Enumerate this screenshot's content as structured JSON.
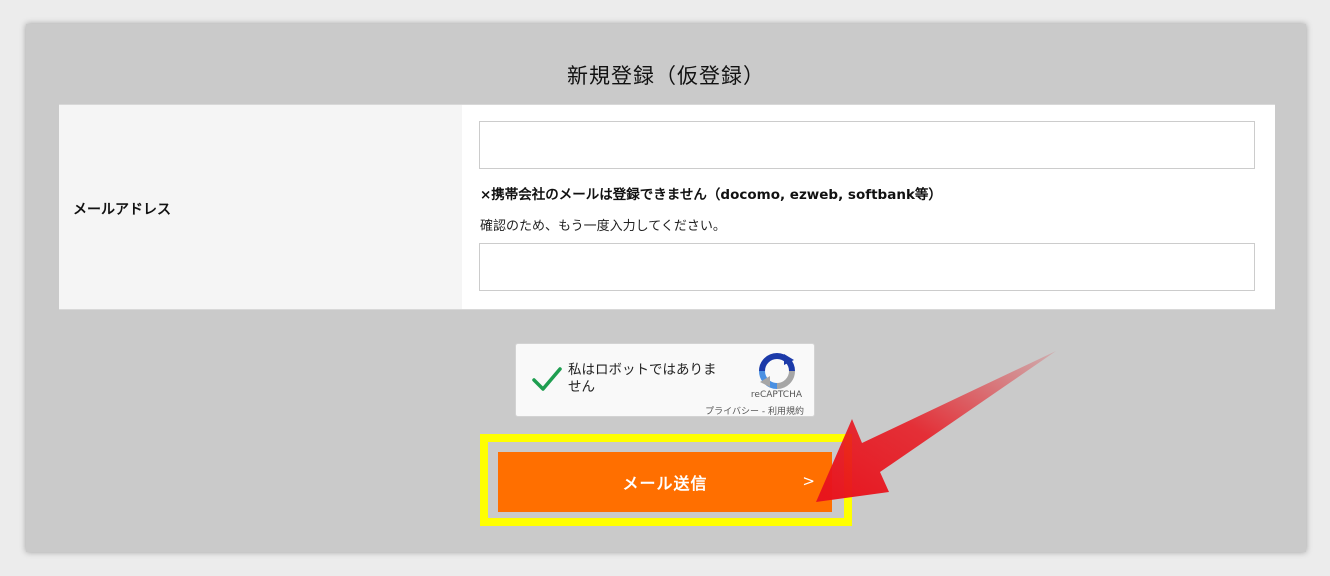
{
  "form": {
    "title": "新規登録（仮登録）",
    "email_label": "メールアドレス",
    "email_value": "",
    "email_confirm_value": "",
    "carrier_note": "×携帯会社のメールは登録できません（docomo, ezweb, softbank等）",
    "confirm_hint": "確認のため、もう一度入力してください。"
  },
  "captcha": {
    "label": "私はロボットではありません",
    "brand": "reCAPTCHA",
    "privacy": "プライバシー",
    "separator": " - ",
    "terms": "利用規約",
    "checked": true
  },
  "submit": {
    "label": "メール送信",
    "chevron": ">"
  },
  "colors": {
    "panel_bg": "#cacaca",
    "button": "#ff6f00",
    "highlight": "#ffff00",
    "arrow": "#e8141d",
    "check": "#1e9e50"
  },
  "icons": [
    "checkmark-icon",
    "recaptcha-logo-icon",
    "chevron-right-icon",
    "red-arrow-icon"
  ]
}
